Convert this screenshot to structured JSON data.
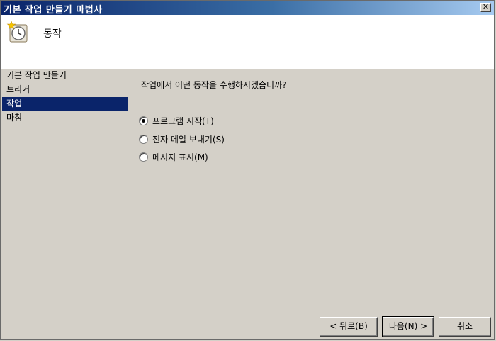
{
  "window": {
    "title": "기본 작업 만들기 마법사",
    "close_label": "✕"
  },
  "header": {
    "title": "동작",
    "icon": "clock-star-icon"
  },
  "sidebar": {
    "items": [
      {
        "label": "기본 작업 만들기",
        "active": false
      },
      {
        "label": "트리거",
        "active": false
      },
      {
        "label": "작업",
        "active": true
      },
      {
        "label": "마침",
        "active": false
      }
    ]
  },
  "main": {
    "question": "작업에서 어떤 동작을 수행하시겠습니까?",
    "options": [
      {
        "label": "프로그램 시작(T)",
        "checked": true
      },
      {
        "label": "전자 메일 보내기(S)",
        "checked": false
      },
      {
        "label": "메시지 표시(M)",
        "checked": false
      }
    ]
  },
  "buttons": {
    "back": "< 뒤로(B)",
    "next": "다음(N) >",
    "cancel": "취소"
  }
}
